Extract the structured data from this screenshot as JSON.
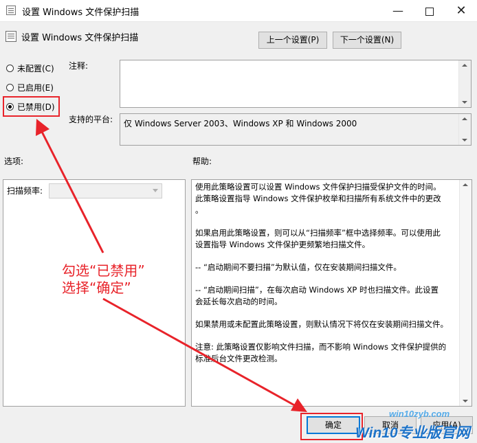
{
  "window": {
    "title": "设置 Windows 文件保护扫描"
  },
  "header": {
    "policy_name": "设置 Windows 文件保护扫描"
  },
  "nav": {
    "prev_label": "上一个设置(P)",
    "next_label": "下一个设置(N)"
  },
  "state": {
    "options": [
      {
        "label": "未配置(C)",
        "selected": false
      },
      {
        "label": "已启用(E)",
        "selected": false
      },
      {
        "label": "已禁用(D)",
        "selected": true
      }
    ]
  },
  "comment": {
    "label": "注释:",
    "value": ""
  },
  "platform": {
    "label": "支持的平台:",
    "value": "仅 Windows Server 2003、Windows XP 和 Windows 2000"
  },
  "options_section": {
    "label": "选项:",
    "scan_freq_label": "扫描频率:",
    "scan_freq_value": ""
  },
  "help_section": {
    "label": "帮助:",
    "paragraphs": [
      [
        "使用此策略设置可以设置 Windows 文件保护扫描受保护文件的时间。",
        "此策略设置指导 Windows 文件保护枚举和扫描所有系统文件中的更改",
        "。"
      ],
      [
        "如果启用此策略设置，则可以从“扫描频率”框中选择频率。可以使用此",
        "设置指导 Windows 文件保护更频繁地扫描文件。"
      ],
      [
        "-- “启动期间不要扫描”为默认值，仅在安装期间扫描文件。"
      ],
      [
        "-- “启动期间扫描”，在每次启动 Windows XP 时也扫描文件。此设置",
        "会延长每次启动的时间。"
      ],
      [
        "如果禁用或未配置此策略设置，则默认情况下将仅在安装期间扫描文件。"
      ],
      [
        "注意: 此策略设置仅影响文件扫描，而不影响 Windows 文件保护提供的",
        "标准后台文件更改检测。"
      ]
    ]
  },
  "buttons": {
    "ok_label": "确定",
    "cancel_label": "取消",
    "apply_label": "应用(A)"
  },
  "annotation": {
    "line1": "勾选“已禁用”",
    "line2": "选择“确定”",
    "color": "#e8232a"
  },
  "watermark": {
    "url": "win10zyb.com",
    "brand": "Win10专业版官网"
  }
}
